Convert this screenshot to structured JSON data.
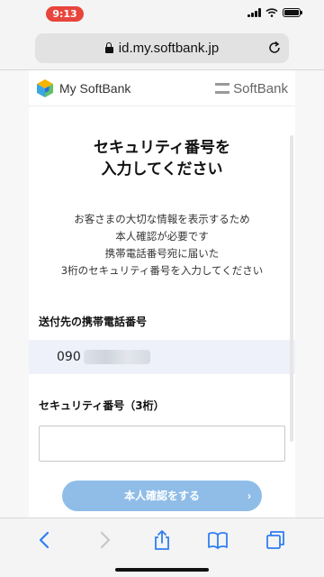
{
  "status_bar": {
    "time": "9:13"
  },
  "browser": {
    "url": "id.my.softbank.jp"
  },
  "header": {
    "app_name": "My SoftBank",
    "brand": "SoftBank"
  },
  "main": {
    "title_lines": [
      "セキュリティ番号を",
      "入力してください"
    ],
    "description_lines": [
      "お客さまの大切な情報を表示するため",
      "本人確認が必要です",
      "携帯電話番号宛に届いた",
      "3桁のセキュリティ番号を入力してください"
    ],
    "phone_label": "送付先の携帯電話番号",
    "phone_prefix": "090",
    "code_label": "セキュリティ番号（3桁）",
    "code_value": "",
    "submit_label": "本人確認をする",
    "submit_arrow": "›"
  },
  "colors": {
    "status_time_bg": "#e8453c",
    "phone_box_bg": "#eef1fa",
    "submit_bg": "#8fbde8",
    "nav_icon_active": "#2f7ef2",
    "nav_icon_disabled": "#c7c7cc"
  },
  "toolbar_icons": [
    "back-icon",
    "forward-icon",
    "share-icon",
    "bookmarks-icon",
    "tabs-icon"
  ]
}
